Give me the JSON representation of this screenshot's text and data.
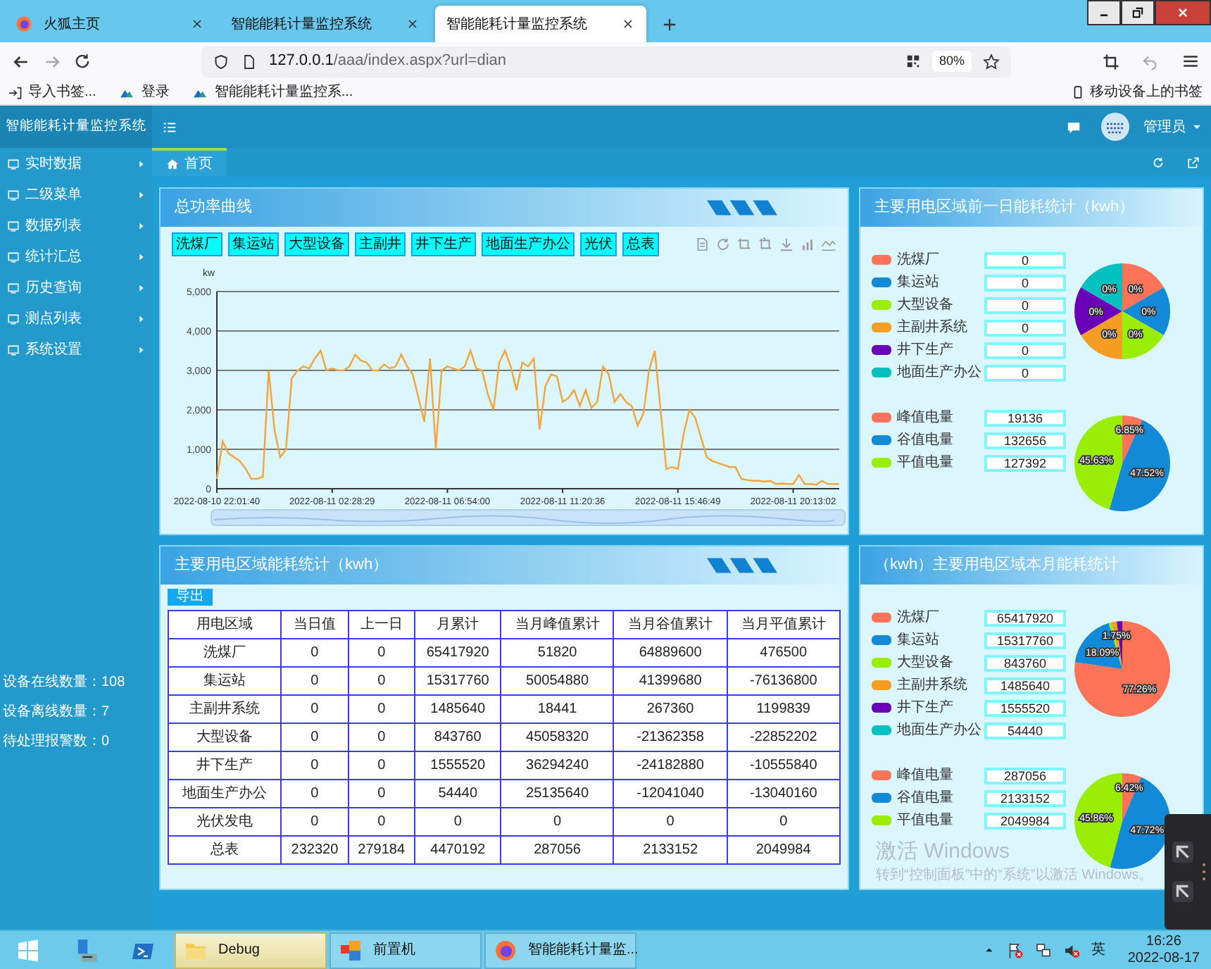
{
  "browser": {
    "tabs": [
      {
        "title": "火狐主页",
        "selected": false,
        "logo": true
      },
      {
        "title": "智能能耗计量监控系统",
        "selected": false,
        "logo": false
      },
      {
        "title": "智能能耗计量监控系统",
        "selected": true,
        "logo": false
      }
    ],
    "url_host": "127.0.0.1",
    "url_path": "/aaa/index.aspx?url=dian",
    "zoom": "80%",
    "bookmarks": [
      {
        "label": "导入书签...",
        "kind": "import"
      },
      {
        "label": "登录",
        "kind": "site"
      },
      {
        "label": "智能能耗计量监控系...",
        "kind": "site"
      }
    ],
    "mobile_bookmarks": "移动设备上的书签"
  },
  "app": {
    "title": "智能能耗计量监控系统",
    "user": "管理员"
  },
  "sidebar": {
    "items": [
      "实时数据",
      "二级菜单",
      "数据列表",
      "统计汇总",
      "历史查询",
      "测点列表",
      "系统设置"
    ],
    "stats": [
      "设备在线数量：108",
      "设备离线数量：7",
      "待处理报警数：0"
    ]
  },
  "page_tabs": [
    {
      "label": "首页",
      "selected": true
    }
  ],
  "power_chart": {
    "title": "总功率曲线",
    "filters": [
      "洗煤厂",
      "集运站",
      "大型设备",
      "主副井",
      "井下生产",
      "地面生产办公",
      "光伏",
      "总表"
    ],
    "chart_data": {
      "type": "line",
      "ylabel": "kw",
      "grid": true,
      "ylim": [
        0,
        5000
      ],
      "categories": [
        "2022-08-10 22:01:40",
        null,
        null,
        null,
        null,
        null,
        null,
        null,
        null,
        null,
        null,
        null,
        null,
        null,
        null,
        null,
        null,
        null,
        null,
        null,
        "2022-08-11 02:28:29",
        null,
        null,
        null,
        null,
        null,
        null,
        null,
        null,
        null,
        null,
        null,
        null,
        null,
        null,
        null,
        null,
        null,
        null,
        null,
        "2022-08-11 06:54:00",
        null,
        null,
        null,
        null,
        null,
        null,
        null,
        null,
        null,
        null,
        null,
        null,
        null,
        null,
        null,
        null,
        null,
        null,
        null,
        "2022-08-11 11:20:36",
        null,
        null,
        null,
        null,
        null,
        null,
        null,
        null,
        null,
        null,
        null,
        null,
        null,
        null,
        null,
        null,
        null,
        null,
        null,
        "2022-08-11 15:46:49",
        null,
        null,
        null,
        null,
        null,
        null,
        null,
        null,
        null,
        null,
        null,
        null,
        null,
        null,
        null,
        null,
        null,
        null,
        null,
        "2022-08-11 20:13:02",
        null,
        null,
        null,
        null,
        null,
        null,
        null,
        null
      ],
      "yticks": [
        0,
        {
          "value": 1000,
          "label": "1,000"
        },
        {
          "value": 2000,
          "label": "2,000"
        },
        {
          "value": 3000,
          "label": "3,000"
        },
        {
          "value": 4000,
          "label": "4,000"
        },
        {
          "value": 5000,
          "label": "5,000"
        }
      ],
      "series": [
        {
          "color": "#f5a33c",
          "values": [
            250,
            1200,
            900,
            800,
            700,
            500,
            250,
            250,
            300,
            3000,
            1500,
            800,
            1000,
            2800,
            3000,
            3100,
            3050,
            3300,
            3500,
            3000,
            3050,
            3000,
            3000,
            3100,
            3400,
            3250,
            3200,
            3000,
            3000,
            3150,
            3050,
            3100,
            3400,
            3100,
            2900,
            2300,
            1700,
            3300,
            1000,
            3000,
            3100,
            3050,
            3000,
            3100,
            3500,
            3050,
            3000,
            2400,
            2000,
            3200,
            3500,
            3100,
            2500,
            3200,
            3100,
            3300,
            1500,
            2600,
            2900,
            2850,
            2200,
            2300,
            2500,
            2100,
            2500,
            2050,
            2200,
            3100,
            2900,
            2200,
            2400,
            2200,
            2100,
            1600,
            1900,
            3000,
            3500,
            2000,
            500,
            550,
            500,
            1400,
            2000,
            1800,
            1300,
            800,
            700,
            650,
            600,
            550,
            550,
            250,
            220,
            200,
            200,
            180,
            200,
            120,
            130,
            120,
            120,
            350,
            120,
            120,
            100,
            200,
            120,
            120,
            120
          ]
        }
      ]
    }
  },
  "stat_panels": [
    {
      "title": "主要用电区域前一日能耗统计（kwh）",
      "areas": [
        {
          "label": "洗煤厂",
          "value": "0",
          "color": "#ff7358"
        },
        {
          "label": "集运站",
          "value": "0",
          "color": "#128ad8"
        },
        {
          "label": "大型设备",
          "value": "0",
          "color": "#9aee06"
        },
        {
          "label": "主副井系统",
          "value": "0",
          "color": "#f59c22"
        },
        {
          "label": "井下生产",
          "value": "0",
          "color": "#6a00b8"
        },
        {
          "label": "地面生产办公",
          "value": "0",
          "color": "#00c0c0"
        }
      ],
      "area_pie": {
        "slice_labels": [
          "0%",
          "0%",
          "0%",
          "0%",
          "0%",
          "0%"
        ]
      },
      "tariffs": [
        {
          "label": "峰值电量",
          "value": "19136",
          "color": "#ff7358"
        },
        {
          "label": "谷值电量",
          "value": "132656",
          "color": "#128ad8"
        },
        {
          "label": "平值电量",
          "value": "127392",
          "color": "#9aee06"
        }
      ],
      "tariff_pie": {
        "chart_data": {
          "type": "pie",
          "values": [
            6.85,
            47.52,
            45.63
          ],
          "value_labels": [
            "6.85%",
            "47.52%",
            "45.63%"
          ]
        }
      }
    },
    {
      "title": "（kwh）主要用电区域本月能耗统计",
      "areas": [
        {
          "label": "洗煤厂",
          "value": "65417920",
          "color": "#ff7358"
        },
        {
          "label": "集运站",
          "value": "15317760",
          "color": "#128ad8"
        },
        {
          "label": "大型设备",
          "value": "843760",
          "color": "#9aee06"
        },
        {
          "label": "主副井系统",
          "value": "1485640",
          "color": "#f59c22"
        },
        {
          "label": "井下生产",
          "value": "1555520",
          "color": "#6a00b8"
        },
        {
          "label": "地面生产办公",
          "value": "54440",
          "color": "#00c0c0"
        }
      ],
      "area_pie": {
        "chart_data": {
          "type": "pie",
          "values": [
            77.26,
            18.09,
            1.0,
            1.75,
            1.84,
            null
          ],
          "value_labels": [
            "77.26%",
            "18.09%",
            null,
            "1.75%",
            null,
            null
          ]
        }
      },
      "tariffs": [
        {
          "label": "峰值电量",
          "value": "287056",
          "color": "#ff7358"
        },
        {
          "label": "谷值电量",
          "value": "2133152",
          "color": "#128ad8"
        },
        {
          "label": "平值电量",
          "value": "2049984",
          "color": "#9aee06"
        }
      ],
      "tariff_pie": {
        "chart_data": {
          "type": "pie",
          "values": [
            6.42,
            47.72,
            45.86
          ],
          "value_labels": [
            "6.42%",
            "47.72%",
            "45.86%"
          ]
        }
      }
    }
  ],
  "table": {
    "title": "主要用电区域能耗统计（kwh）",
    "export": "导出",
    "columns": [
      "用电区域",
      "当日值",
      "上一日",
      "月累计",
      "当月峰值累计",
      "当月谷值累计",
      "当月平值累计"
    ],
    "rows": [
      [
        "洗煤厂",
        "0",
        "0",
        "65417920",
        "51820",
        "64889600",
        "476500"
      ],
      [
        "集运站",
        "0",
        "0",
        "15317760",
        "50054880",
        "41399680",
        "-76136800"
      ],
      [
        "主副井系统",
        "0",
        "0",
        "1485640",
        "18441",
        "267360",
        "1199839"
      ],
      [
        "大型设备",
        "0",
        "0",
        "843760",
        "45058320",
        "-21362358",
        "-22852202"
      ],
      [
        "井下生产",
        "0",
        "0",
        "1555520",
        "36294240",
        "-24182880",
        "-10555840"
      ],
      [
        "地面生产办公",
        "0",
        "0",
        "54440",
        "25135640",
        "-12041040",
        "-13040160"
      ],
      [
        "光伏发电",
        "0",
        "0",
        "0",
        "0",
        "0",
        "0"
      ],
      [
        "总表",
        "232320",
        "279184",
        "4470192",
        "287056",
        "2133152",
        "2049984"
      ]
    ]
  },
  "activation_notice": {
    "title": "激活 Windows",
    "text": "转到“控制面板”中的“系统”以激活 Windows。"
  },
  "taskbar": {
    "apps": [
      {
        "label": "Debug",
        "kind": "folder",
        "selected": true
      },
      {
        "label": "前置机",
        "kind": "app",
        "selected": false
      },
      {
        "label": "智能能耗计量监...",
        "kind": "browser",
        "selected": false
      }
    ],
    "ime": "英",
    "time": "16:26",
    "date": "2022-08-17"
  }
}
